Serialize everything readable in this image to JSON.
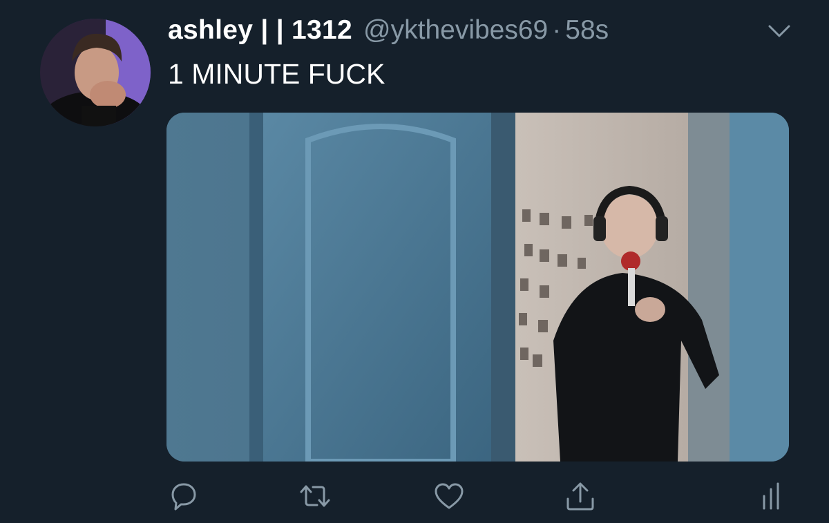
{
  "tweet": {
    "display_name": "ashley | | 1312",
    "handle": "@ykthevibes69",
    "separator": "·",
    "time": "58s",
    "text": "1 MINUTE FUCK"
  },
  "icons": {
    "menu": "chevron-down-icon",
    "reply": "reply-icon",
    "retweet": "retweet-icon",
    "like": "heart-icon",
    "share": "share-icon",
    "analytics": "analytics-icon"
  },
  "colors": {
    "background": "#15202b",
    "primary_text": "#ffffff",
    "secondary_text": "#8899a6"
  }
}
